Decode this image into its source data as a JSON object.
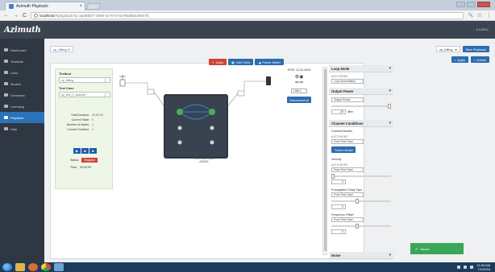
{
  "browser": {
    "tab_title": "Azimuth Playback",
    "tab_close": "×",
    "url_host": "localhost",
    "url_rest": "/#/playback?p=aad65f47-2560-4c7e-874e-85db8ed6847b",
    "back": "←",
    "forward": "→",
    "reload": "C",
    "zoom_icon": "🔍",
    "star_icon": "☆",
    "menu_icon": "⋮"
  },
  "app": {
    "logo": "Azimuth",
    "user": "▾ AAB12"
  },
  "sidebar": {
    "items": [
      {
        "label": "Dashboard",
        "icon": "dashboard-icon"
      },
      {
        "label": "Testbeds",
        "icon": "testbeds-icon"
      },
      {
        "label": "Links",
        "icon": "links-icon"
      },
      {
        "label": "Models",
        "icon": "models-icon"
      },
      {
        "label": "Scenarios",
        "icon": "scenarios-icon"
      },
      {
        "label": "Licensing",
        "icon": "licensing-icon"
      },
      {
        "label": "Playback",
        "icon": "playback-icon",
        "active": true
      },
      {
        "label": "Help",
        "icon": "help-icon"
      }
    ]
  },
  "content": {
    "doc_tab": "cp_billing ✕",
    "picker_value": "cp_billing",
    "new_playback": "New Playback",
    "apply": "Apply",
    "delete": "Delete",
    "links_btn": "Links",
    "grid_view": "Grid View",
    "power_meter": "Power Meter"
  },
  "controls": {
    "testbed_label": "Testbed",
    "testbed_value": "cp_billing",
    "testcase_label": "Test Case",
    "testcase_value": "cp_test_2_channel",
    "stats": [
      {
        "k": "Total Duration:",
        "v": "00:00:00"
      },
      {
        "k": "Current State:",
        "v": "0"
      },
      {
        "k": "Number of states:",
        "v": "1"
      },
      {
        "k": "Current Duration:",
        "v": "1"
      }
    ],
    "play": "▶",
    "pause": "■",
    "stop": "■",
    "status_label": "Status:",
    "status_value": "Stopped",
    "time_label": "Time:",
    "time_value": "00:00:00"
  },
  "topology": {
    "device_label": "RSSI: 12-51-4819",
    "center_label": "RMC 123-4556",
    "center_sub": "ANSB1",
    "link_select": "Link 1",
    "disconnect": "Disconnect ⇄"
  },
  "settings": {
    "loop_mode": {
      "title": "Loop Mode",
      "sub": "AUTO MODE",
      "value": "Loop Immediately"
    },
    "output_power": {
      "title": "Output Power",
      "value": "Output Power",
      "number": "-20",
      "unit": "dBm"
    },
    "channel_conditions": {
      "title": "Channel Conditions"
    },
    "channel_models": {
      "label": "Channel Models",
      "sub": "AUTO MODE",
      "value": "From Test Case",
      "button": "Select Model"
    },
    "velocity": {
      "label": "Velocity",
      "sub": "AUTO MODE",
      "value": "From Test Case",
      "number": "0"
    },
    "doppler": {
      "label": "Propagation Delay Type",
      "value": "From Test Case",
      "number": "0"
    },
    "freq_offset": {
      "label": "Frequency Offset",
      "value": "From Test Case",
      "number": "0"
    },
    "noise": {
      "title": "Noise"
    }
  },
  "toast": {
    "icon": "✔",
    "text": "Saved"
  },
  "taskbar": {
    "time": "11:06 AM",
    "date": "7/1/2016"
  }
}
